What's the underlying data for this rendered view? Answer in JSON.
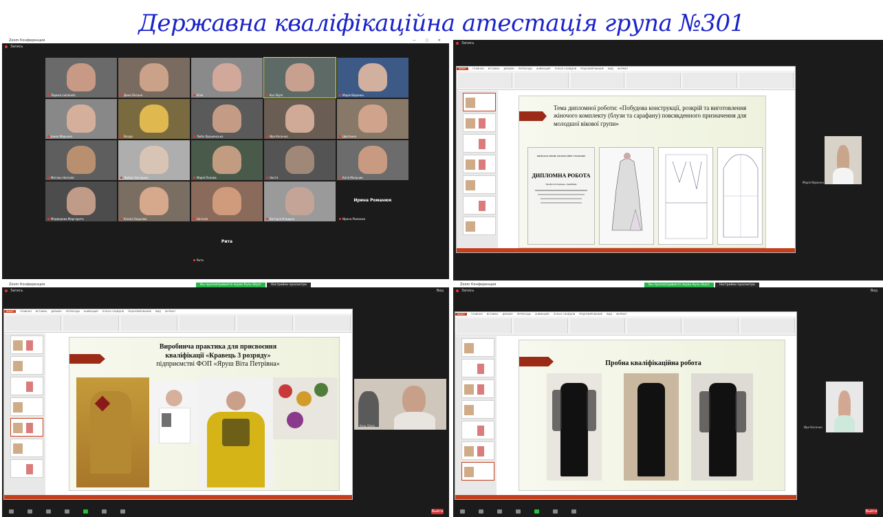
{
  "header": {
    "title": "Державна кваліфікаційна атестація група №301"
  },
  "zoom": {
    "app_title": "Zoom Конференция",
    "recording_label": "Запись",
    "view_label": "Вид",
    "share_notice": "Вы просматриваете экран Кузь Sliym",
    "view_options": "Настройки просмотра",
    "end_label": "Выйти"
  },
  "gallery": {
    "participants": [
      {
        "name": "Лариса Lukianets",
        "skin": "#c89a86",
        "bg": "#6a6a6a"
      },
      {
        "name": "Дина Оксана",
        "skin": "#caa28a",
        "bg": "#7a6b60"
      },
      {
        "name": "Юля",
        "skin": "#d1a89a",
        "bg": "#8a8a8a"
      },
      {
        "name": "Kuz Sliym",
        "skin": "#c8a090",
        "bg": "#5e6a66"
      },
      {
        "name": "Марія Воронко",
        "skin": "#d2b0a0",
        "bg": "#3d5a86"
      },
      {
        "name": "Ірина Марьяна",
        "skin": "#d4b09c",
        "bg": "#888888"
      },
      {
        "name": "Влада",
        "skin": "#e0b850",
        "bg": "#7a6a40"
      },
      {
        "name": "Люба Ярошенська",
        "skin": "#c49c86",
        "bg": "#5a5a5a"
      },
      {
        "name": "Ира Косенко",
        "skin": "#d0aa96",
        "bg": "#6a5e54"
      },
      {
        "name": "Цветанко",
        "skin": "#d0a48c",
        "bg": "#887868"
      },
      {
        "name": "Мотлан Наталія",
        "skin": "#b89070",
        "bg": "#5e5e5e"
      },
      {
        "name": "Любов Заячишко",
        "skin": "#d8c4b4",
        "bg": "#aeaeae"
      },
      {
        "name": "Марія Попова",
        "skin": "#c29c80",
        "bg": "#4a5a4a"
      },
      {
        "name": "Настя",
        "skin": "#a08878",
        "bg": "#545454"
      },
      {
        "name": "Катя Мельник",
        "skin": "#c89a82",
        "bg": "#6c6c6c"
      },
      {
        "name": "Медведева Маргарита",
        "skin": "#c09c88",
        "bg": "#4c4c4c"
      },
      {
        "name": "Ксенія Хацьпюк",
        "skin": "#d6a88c",
        "bg": "#7a6e62"
      },
      {
        "name": "Наталія",
        "skin": "#d09a7c",
        "bg": "#8a6a5a"
      },
      {
        "name": "Вікторія Кладько",
        "skin": "#c4a496",
        "bg": "#9a9a9a"
      },
      {
        "name": "Ирина Романюк",
        "black": true,
        "big": "Ирина Романюк"
      },
      {
        "name": "Рита",
        "black": true,
        "big": "Рита"
      }
    ]
  },
  "presentation": {
    "ribbon_tabs": [
      "ФАЙЛ",
      "ГЛАВНАЯ",
      "ВСТАВКА",
      "ДИЗАЙН",
      "ПЕРЕХОДЫ",
      "АНИМАЦИЯ",
      "ПОКАЗ СЛАЙДОВ",
      "РЕЦЕНЗИРОВАНИЕ",
      "ВИД",
      "ФОРМАТ"
    ],
    "slide2_title": "Тема дипломної роботи: «Побудова конструкції, розкрій та виготовлення жіночого комплекту (блузи та сарафану) повсякденного призначення для молодшої вікової групи»",
    "card_header": "КИЇВСЬКЕ ВИЩЕ ПРОФЕСІЙНЕ УЧИЛИЩЕ",
    "card_title": "ДИПЛОМНА РОБОТА",
    "card_profession": "Професія: Кравець. Закрійник",
    "slide3_title_1": "Виробнича практика для присвоєння",
    "slide3_title_2": "кваліфікації «Кравець 3 розряду»",
    "slide3_title_3": "підприємстві ФОП «Яруш Віта Петрівна»",
    "slide4_title": "Пробна кваліфікаційна робота"
  },
  "videos": {
    "w2_name": "Марія Воронко",
    "w3_name": "Кузь Sliym",
    "w4_name": "Ира Косенко"
  }
}
